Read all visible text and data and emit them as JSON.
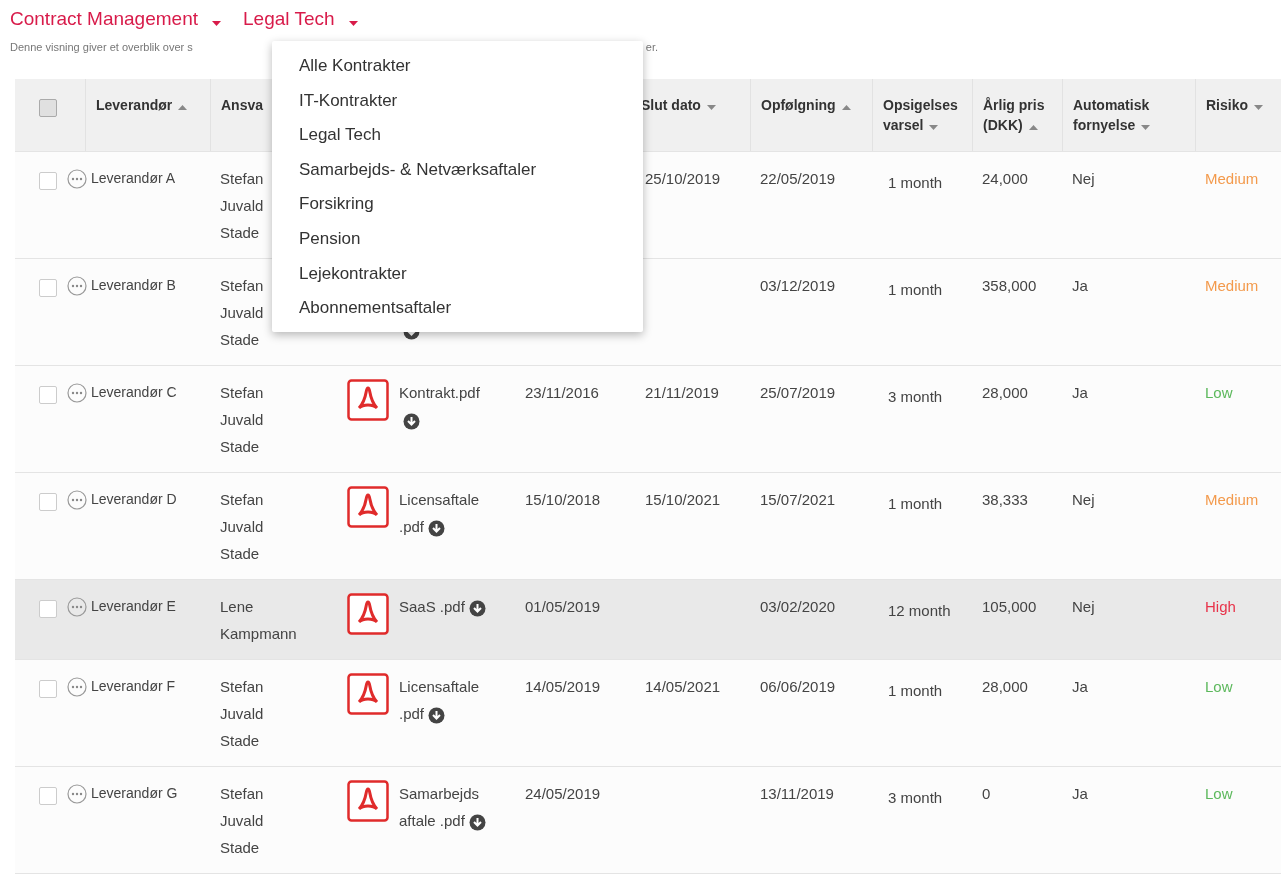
{
  "header": {
    "menus": [
      {
        "label": "Contract Management"
      },
      {
        "label": "Legal Tech"
      }
    ],
    "description_parts": [
      "Denne visning giver et overblik over s",
      "er."
    ]
  },
  "dropdown": {
    "items": [
      {
        "label": "Alle Kontrakter"
      },
      {
        "label": "IT-Kontrakter"
      },
      {
        "label": "Legal Tech"
      },
      {
        "label": "Samarbejds- & Netværksaftaler"
      },
      {
        "label": "Forsikring"
      },
      {
        "label": "Pension"
      },
      {
        "label": "Lejekontrakter"
      },
      {
        "label": "Abonnementsaftaler"
      }
    ]
  },
  "table": {
    "select_all_checked": false,
    "columns": [
      {
        "label": "Leverandør",
        "sort": {
          "ascending": true
        }
      },
      {
        "label": "Ansva"
      },
      {
        "label": "Slut dato",
        "sort": {
          "ascending": false
        }
      },
      {
        "label": "Opfølgning",
        "sort": {
          "ascending": true
        }
      },
      {
        "label": "Opsigelses varsel",
        "sort": {
          "ascending": false
        }
      },
      {
        "label": "Årlig pris (DKK)",
        "sort": {
          "ascending": true
        }
      },
      {
        "label": "Automatisk fornyelse",
        "sort": {
          "ascending": false
        }
      },
      {
        "label": "Risiko",
        "sort": {
          "ascending": false
        }
      }
    ],
    "rows": [
      {
        "checked": false,
        "highlighted": false,
        "supplier": "Leverandør A",
        "owner": "Stefan Juvald Stade",
        "end": "25/10/2019",
        "followup": "22/05/2019",
        "notice": "1 month",
        "price": "24,000",
        "renewal": "Nej",
        "risk": {
          "label": "Medium",
          "color": "#f39a4c"
        }
      },
      {
        "checked": false,
        "highlighted": false,
        "supplier": "Leverandør B",
        "owner": "Stefan Juvald Stade",
        "followup": "03/12/2019",
        "notice": "1 month",
        "price": "358,000",
        "renewal": "Ja",
        "risk": {
          "label": "Medium",
          "color": "#f39a4c"
        }
      },
      {
        "checked": false,
        "highlighted": false,
        "supplier": "Leverandør C",
        "owner": "Stefan Juvald Stade",
        "file": "Kontrakt.pdf",
        "start": "23/11/2016",
        "end": "21/11/2019",
        "followup": "25/07/2019",
        "notice": "3 month",
        "price": "28,000",
        "renewal": "Ja",
        "risk": {
          "label": "Low",
          "color": "#5cb85c"
        }
      },
      {
        "checked": false,
        "highlighted": false,
        "supplier": "Leverandør D",
        "owner": "Stefan Juvald Stade",
        "file": "Licensaftale .pdf",
        "start": "15/10/2018",
        "end": "15/10/2021",
        "followup": "15/07/2021",
        "notice": "1 month",
        "price": "38,333",
        "renewal": "Nej",
        "risk": {
          "label": "Medium",
          "color": "#f39a4c"
        }
      },
      {
        "checked": false,
        "highlighted": true,
        "supplier": "Leverandør E",
        "owner": "Lene Kampmann",
        "file": "SaaS .pdf",
        "start": "01/05/2019",
        "followup": "03/02/2020",
        "notice": "12 month",
        "price": "105,000",
        "renewal": "Nej",
        "risk": {
          "label": "High",
          "color": "#e8334a"
        }
      },
      {
        "checked": false,
        "highlighted": false,
        "supplier": "Leverandør F",
        "owner": "Stefan Juvald Stade",
        "file": "Licensaftale .pdf",
        "start": "14/05/2019",
        "end": "14/05/2021",
        "followup": "06/06/2019",
        "notice": "1 month",
        "price": "28,000",
        "renewal": "Ja",
        "risk": {
          "label": "Low",
          "color": "#5cb85c"
        }
      },
      {
        "checked": false,
        "highlighted": false,
        "supplier": "Leverandør G",
        "owner": "Stefan Juvald Stade",
        "file": "Samarbejds aftale .pdf",
        "start": "24/05/2019",
        "followup": "13/11/2019",
        "notice": "3 month",
        "price": "0",
        "renewal": "Ja",
        "risk": {
          "label": "Low",
          "color": "#5cb85c"
        }
      }
    ]
  }
}
